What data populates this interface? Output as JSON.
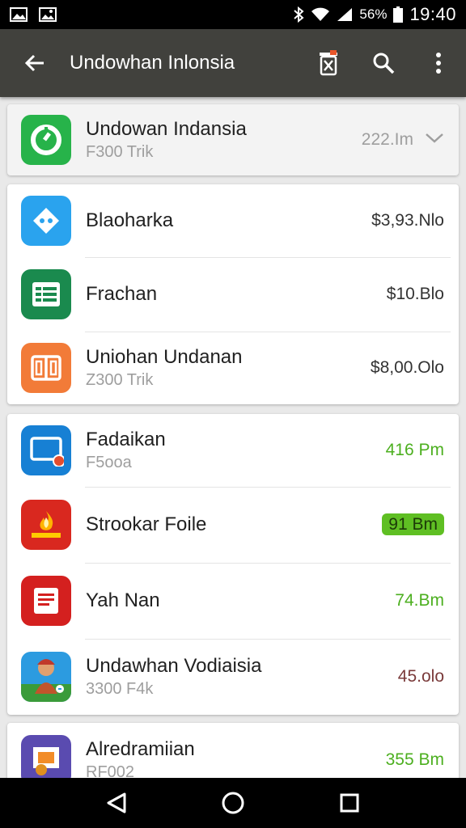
{
  "status_bar": {
    "battery_text": "56%",
    "time": "19:40"
  },
  "app_bar": {
    "title": "Undowhan Inlonsia",
    "back_icon": "arrow-back-icon",
    "actions": [
      "trash-icon",
      "search-icon",
      "more-vert-icon"
    ]
  },
  "header_item": {
    "name": "Undowan Indansia",
    "sub": "F300 Trik",
    "size": "222.Im",
    "icon": "refresh-app-icon",
    "color": "#27b34a"
  },
  "group1": [
    {
      "name": "Blaoharka",
      "sub": "",
      "size": "$3,93.Nlo",
      "icon": "game-controller-icon",
      "color": "#2aa3ee"
    },
    {
      "name": "Frachan",
      "sub": "",
      "size": "$10.Blo",
      "icon": "spreadsheet-icon",
      "color": "#1a8a4e"
    },
    {
      "name": "Uniohan Undanan",
      "sub": "Z300 Trik",
      "size": "$8,00.Olo",
      "icon": "book-icon",
      "color": "#f27b38"
    }
  ],
  "group2": [
    {
      "name": "Fadaikan",
      "sub": "F5ooa",
      "size": "416 Pm",
      "icon": "screen-app-icon",
      "color": "#1780d4",
      "size_style": "green"
    },
    {
      "name": "Strookar Foile",
      "sub": "",
      "size": "91 Bm",
      "icon": "flame-app-icon",
      "color": "#d9281f",
      "size_style": "pill"
    },
    {
      "name": "Yah Nan",
      "sub": "",
      "size": "74.Bm",
      "icon": "document-icon",
      "color": "#d4201f",
      "size_style": "green"
    },
    {
      "name": "Undawhan Vodiaisia",
      "sub": "3300 F4k",
      "size": "45.olo",
      "icon": "game-character-icon",
      "color": "#2c9be0",
      "size_style": "dark-red"
    }
  ],
  "group3": [
    {
      "name": "Alredramiian",
      "sub": "RF002",
      "size": "355 Bm",
      "icon": "basketball-app-icon",
      "color": "#5a4bb0",
      "size_style": "green"
    }
  ],
  "nav_bar": [
    "back-triangle-icon",
    "home-circle-icon",
    "recents-square-icon"
  ]
}
